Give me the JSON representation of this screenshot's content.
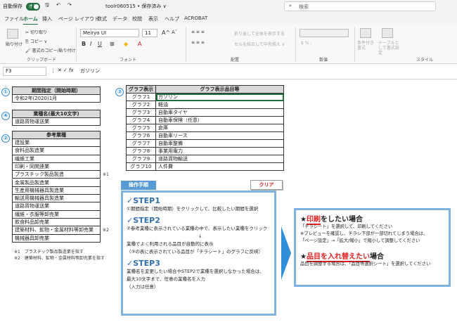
{
  "titlebar": {
    "autosave_label": "自動保存",
    "autosave_state": "オン",
    "filename": "toolr060515 • 保存済み ∨",
    "search_placeholder": "検索"
  },
  "tabs": [
    "ファイル",
    "ホーム",
    "挿入",
    "ページ レイアウト",
    "数式",
    "データ",
    "校閲",
    "表示",
    "ヘルプ",
    "ACROBAT"
  ],
  "active_tab": "ホーム",
  "ribbon": {
    "paste_label": "貼り付け",
    "cut_label": "切り取り",
    "copy_label": "コピー ∨",
    "format_painter_label": "書式のコピー/貼り付け",
    "clipboard_group": "クリップボード",
    "font_name": "Meiryo UI",
    "font_size": "11",
    "font_group": "フォント",
    "wrap_text_label": "折り返して全体を表示する",
    "merge_center_label": "セルを結合して中央揃え ∨",
    "align_group": "配置",
    "number_format": "",
    "number_group": "数値",
    "cond_format_label": "条件付き書式",
    "table_format_label": "テーブルとして書式設定",
    "style_group": "スタイル"
  },
  "formula_bar": {
    "name_box": "F3",
    "fx_label": "fx",
    "content": "ガソリン"
  },
  "sheet": {
    "badges": [
      "①",
      "④",
      "②",
      "③"
    ],
    "period_header": "期間指定（開始時期）",
    "period_value": "令和2年(2020)1月",
    "industry_name_header": "業種名(最大10文字)",
    "industry_name_value": "道路貨物運送業",
    "ref_industry_header": "参考業種",
    "industries": [
      "建設業",
      "食料品製造業",
      "繊維工業",
      "印刷・同関連業",
      "プラスチック製品製造",
      "金属製品製造業",
      "生産用機械器具製造業",
      "輸送用機械器具製造業",
      "道路貨物運送業",
      "繊維・衣服等卸売業",
      "飲食料品卸売業",
      "建築材料、鉱物・金属材料等卸売業",
      "機械器具卸売業"
    ],
    "industry_marks": [
      "",
      "",
      "",
      "",
      "※1",
      "",
      "",
      "",
      "",
      "",
      "",
      "※2",
      ""
    ],
    "notes": [
      "※1　プラスチック製品製造業を指す",
      "※2　建築材料、鉱物・金属材料等卸売業を指す"
    ],
    "graph_table": {
      "headers": [
        "グラフ表示",
        "グラフ表示品目等"
      ],
      "rows": [
        [
          "グラフ1",
          "ガソリン"
        ],
        [
          "グラフ2",
          "軽油"
        ],
        [
          "グラフ3",
          "自動車タイヤ"
        ],
        [
          "グラフ4",
          "自動車保険（任意）"
        ],
        [
          "グラフ5",
          "倉庫"
        ],
        [
          "グラフ6",
          "自動車リース"
        ],
        [
          "グラフ7",
          "自動車整備"
        ],
        [
          "グラフ8",
          "事業用電力"
        ],
        [
          "グラフ9",
          "道路貨物輸送"
        ],
        [
          "グラフ10",
          "人件費"
        ]
      ]
    }
  },
  "buttons": {
    "steps_label": "操作手順",
    "clear_label": "クリア"
  },
  "steps": [
    {
      "title": "✓STEP1",
      "lines": [
        "①期間指定（開始時期）をクリックして、比較したい期間を選択"
      ]
    },
    {
      "title": "✓STEP2",
      "lines": [
        "②参考業種に表示されている業種の中で、表示したい業種をクリック",
        "↓",
        "業種でよく利用される品目が自動的に表示",
        "（③の表に表示されている品目が「チラシート」のグラフに反映）"
      ]
    },
    {
      "title": "✓STEP3",
      "lines": [
        "業種名を変更したい場合やSTEP2で業種を選択しなかった場合は、",
        "最大10文字まで、任意の業種名を入力",
        "（入力は任意）"
      ]
    }
  ],
  "instructions": {
    "print_prefix": "★",
    "print_key": "印刷",
    "print_suffix": "をしたい場合",
    "print_lines": [
      "「チラシート」を選択して、印刷してください",
      "※プレビューを確認し、チラシ下部が一部切れてしまう場合は、",
      "「ページ設定」→「拡大/縮小」で縮小して調整してください"
    ],
    "swap_prefix": "★",
    "swap_key": "品目を入れ替えたい",
    "swap_suffix": "場合",
    "swap_lines": [
      "品目を調整する場合は、「品目等選択シート」を選択してください"
    ]
  },
  "colors": {
    "excel_green": "#1f6f3f",
    "accent_blue": "#2f8fd8",
    "box_border": "#7fb3e0",
    "red": "#e02020"
  }
}
